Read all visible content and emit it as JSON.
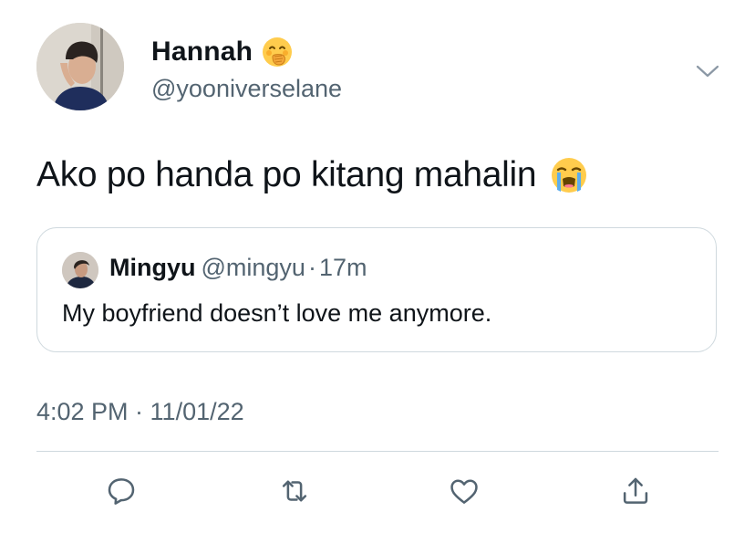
{
  "tweet": {
    "display_name": "Hannah",
    "name_emoji": "face-with-hand-over-mouth-emoji",
    "handle": "@yooniverselane",
    "text": "Ako po handa po kitang mahalin",
    "text_emoji": "loudly-crying-face-emoji",
    "timestamp": "4:02 PM · 11/01/22"
  },
  "quoted_tweet": {
    "display_name": "Mingyu",
    "handle": "@mingyu",
    "separator": "·",
    "time": "17m",
    "text": "My boyfriend doesn’t love me anymore."
  },
  "actions": [
    {
      "icon": "reply-icon"
    },
    {
      "icon": "retweet-icon"
    },
    {
      "icon": "like-icon"
    },
    {
      "icon": "share-icon"
    }
  ],
  "colors": {
    "text": "#0f1419",
    "secondary_text": "#536471",
    "border": "#cfd9de"
  }
}
